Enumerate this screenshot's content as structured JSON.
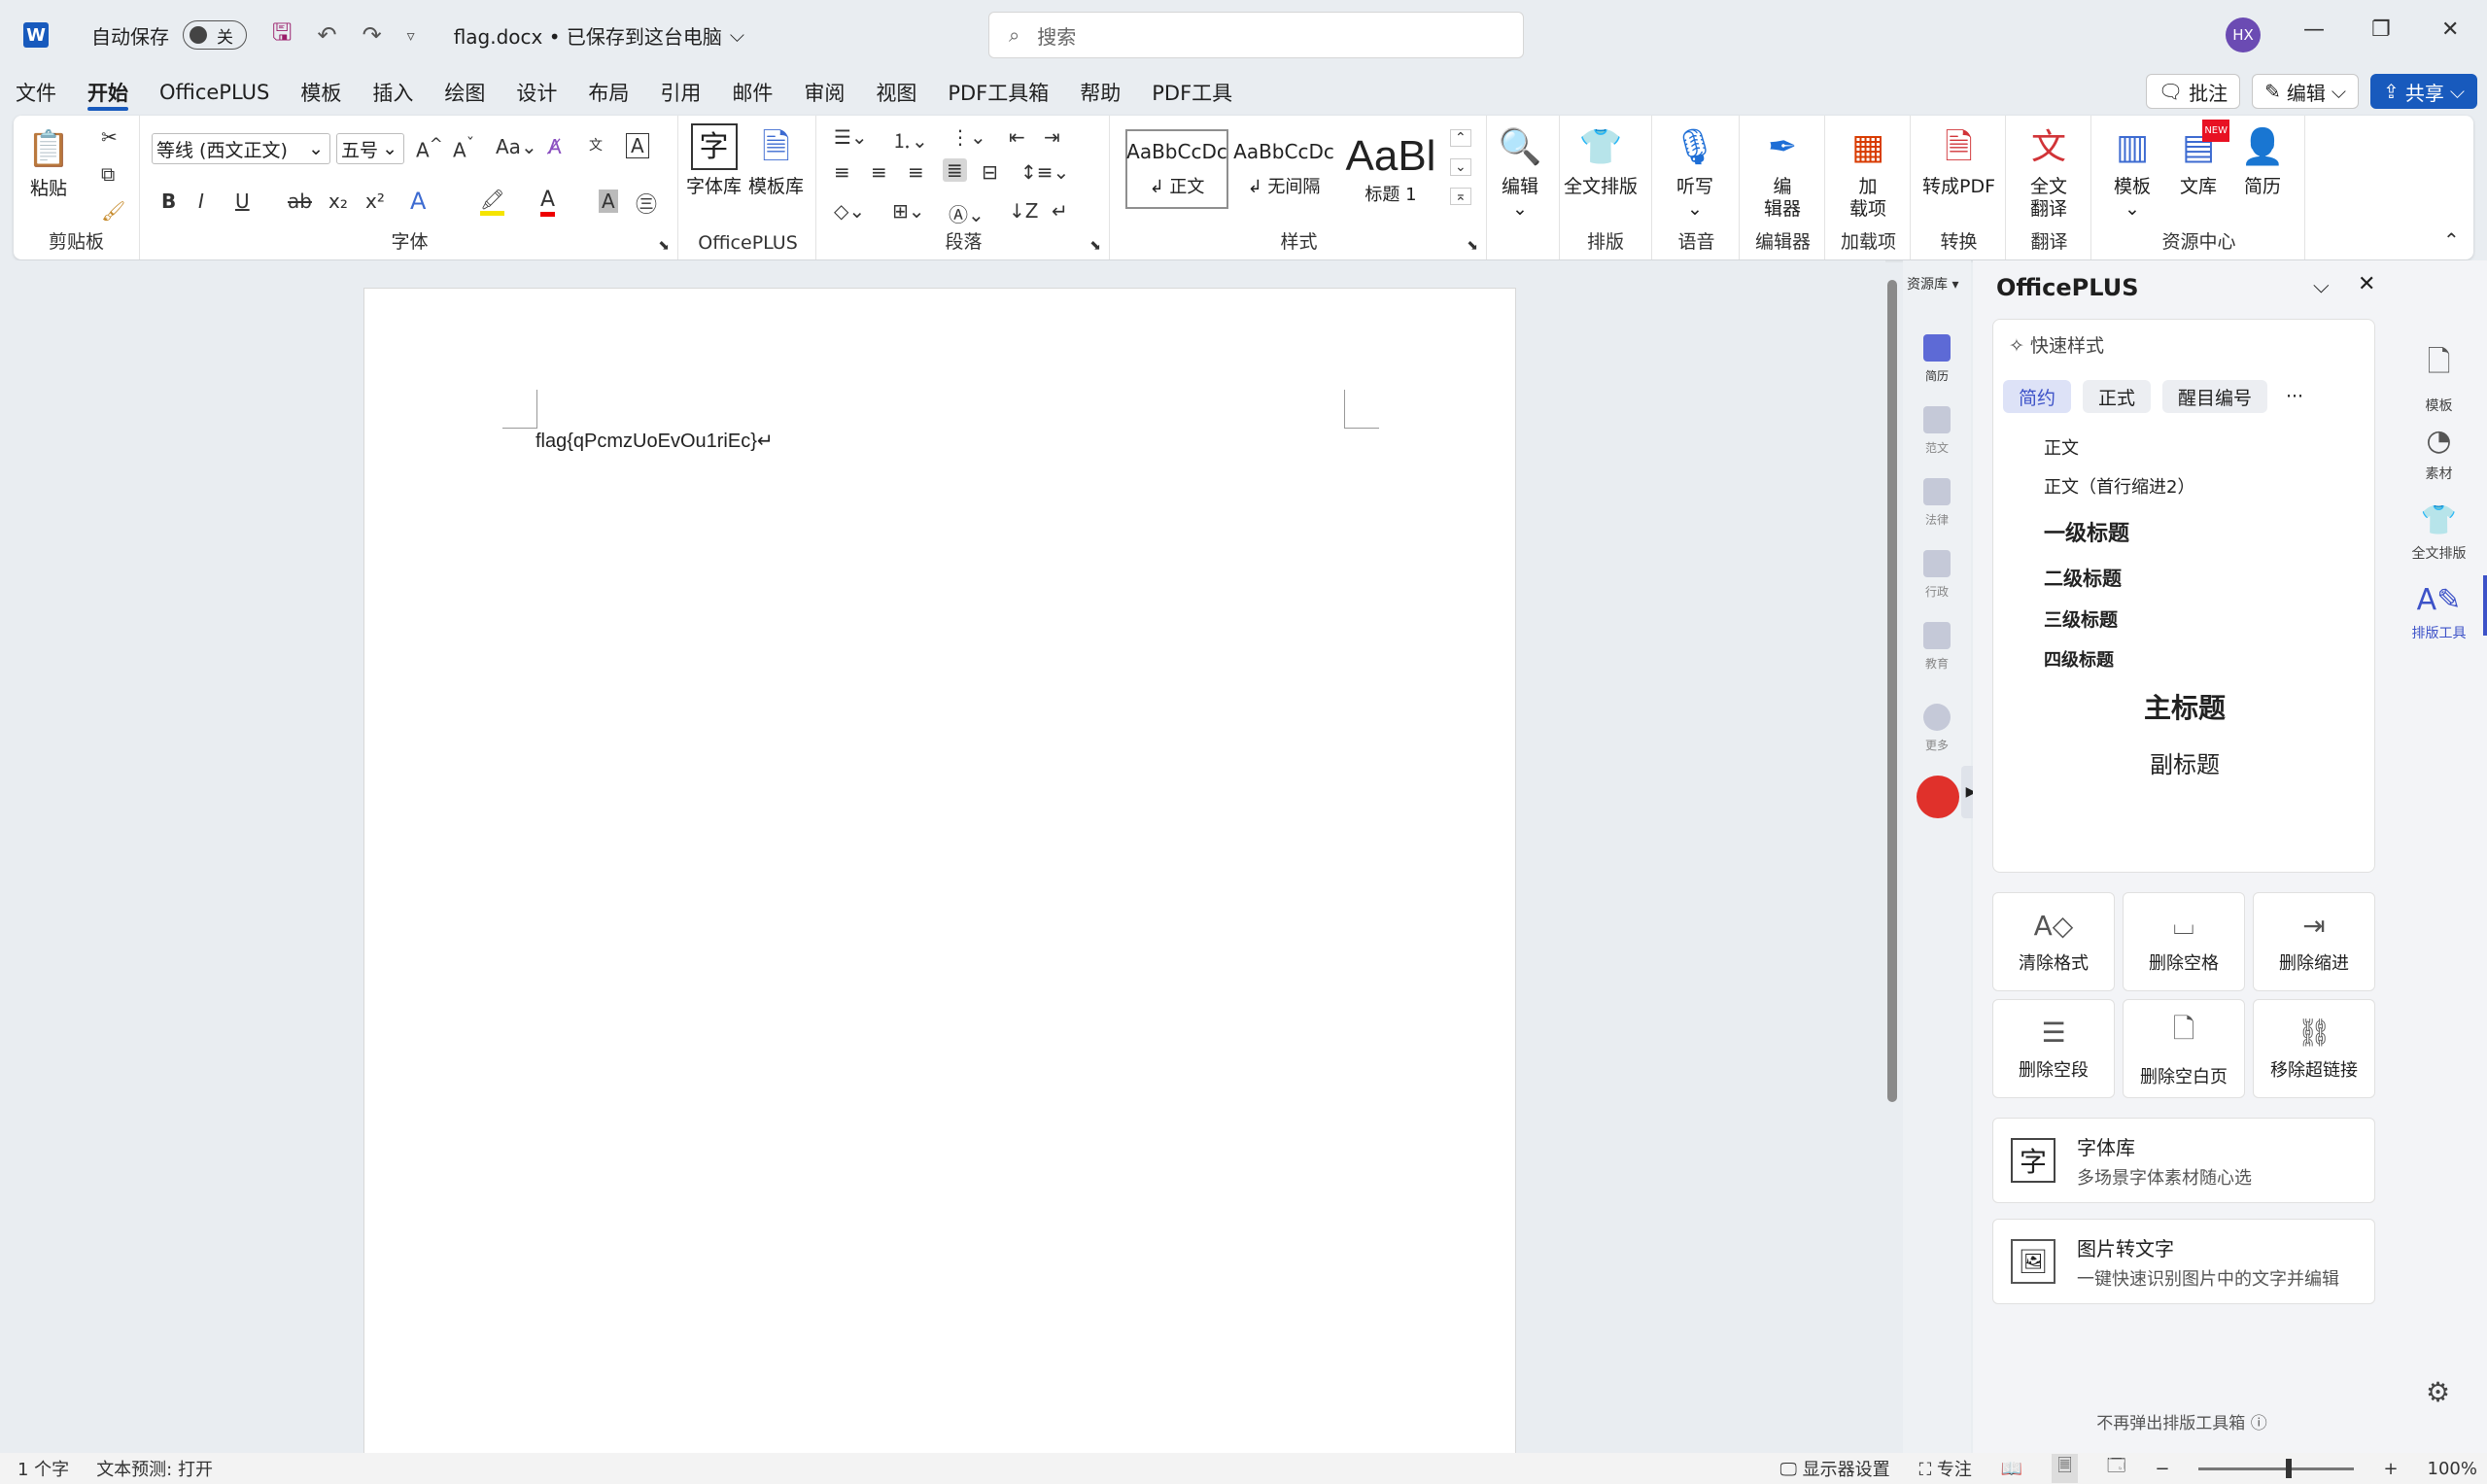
{
  "titlebar": {
    "autosave_label": "自动保存",
    "autosave_state": "关",
    "doc_title": "flag.docx • 已保存到这台电脑",
    "search_placeholder": "搜索",
    "avatar_initials": "HX"
  },
  "menu": {
    "tabs": [
      "文件",
      "开始",
      "OfficePLUS",
      "模板",
      "插入",
      "绘图",
      "设计",
      "布局",
      "引用",
      "邮件",
      "审阅",
      "视图",
      "PDF工具箱",
      "帮助",
      "PDF工具"
    ],
    "active": "开始",
    "comment_label": "批注",
    "edit_label": "编辑",
    "share_label": "共享"
  },
  "ribbon": {
    "clipboard": {
      "paste": "粘贴",
      "label": "剪贴板"
    },
    "font": {
      "name": "等线 (西文正文)",
      "size": "五号",
      "label": "字体",
      "case_btn": "Aa"
    },
    "officeplus": {
      "fontlib": "字体库",
      "templatelib": "模板库",
      "label": "OfficePLUS"
    },
    "paragraph": {
      "label": "段落"
    },
    "styles": {
      "items": [
        {
          "preview": "AaBbCcDc",
          "name": "↲ 正文"
        },
        {
          "preview": "AaBbCcDc",
          "name": "↲ 无间隔"
        },
        {
          "preview": "AaBl",
          "name": "标题 1"
        }
      ],
      "label": "样式"
    },
    "editing": {
      "btn": "编辑"
    },
    "layout": {
      "btn": "全文排版",
      "label": "排版"
    },
    "voice": {
      "btn": "听写",
      "label": "语音"
    },
    "editor": {
      "btn": "编\n辑器",
      "label": "编辑器"
    },
    "addins": {
      "btn": "加\n载项",
      "label": "加载项"
    },
    "convert": {
      "btn": "转成PDF",
      "label": "转换"
    },
    "translate": {
      "btn": "全文\n翻译",
      "label": "翻译"
    },
    "resources": {
      "btn1": "模板",
      "btn2": "文库",
      "btn3": "简历",
      "new_badge": "NEW",
      "label": "资源中心"
    }
  },
  "document": {
    "text": "flag{qPcmzUoEvOu1riEc}↵"
  },
  "res_strip": {
    "header": "资源库",
    "items": [
      "简历",
      "范文",
      "法律",
      "行政",
      "教育",
      "更多"
    ]
  },
  "panel": {
    "title": "OfficePLUS",
    "quick_styles": "快速样式",
    "chips": [
      "简约",
      "正式",
      "醒目编号",
      "···"
    ],
    "styles": [
      "正文",
      "正文（首行缩进2）",
      "一级标题",
      "二级标题",
      "三级标题",
      "四级标题",
      "主标题",
      "副标题"
    ],
    "tools": [
      "清除格式",
      "删除空格",
      "删除缩进",
      "删除空段",
      "删除空白页",
      "移除超链接"
    ],
    "feature1": {
      "title": "字体库",
      "sub": "多场景字体素材随心选"
    },
    "feature2": {
      "title": "图片转文字",
      "sub": "一键快速识别图片中的文字并编辑"
    },
    "footer": "不再弹出排版工具箱 ⓘ"
  },
  "rail": {
    "items": [
      "模板",
      "素材",
      "全文排版",
      "排版工具"
    ]
  },
  "status": {
    "words": "1 个字",
    "prediction": "文本预测: 打开",
    "display_settings": "显示器设置",
    "focus": "专注",
    "zoom": "100%"
  },
  "colors": {
    "accent": "#185abd",
    "panel_accent": "#3d52c8"
  }
}
